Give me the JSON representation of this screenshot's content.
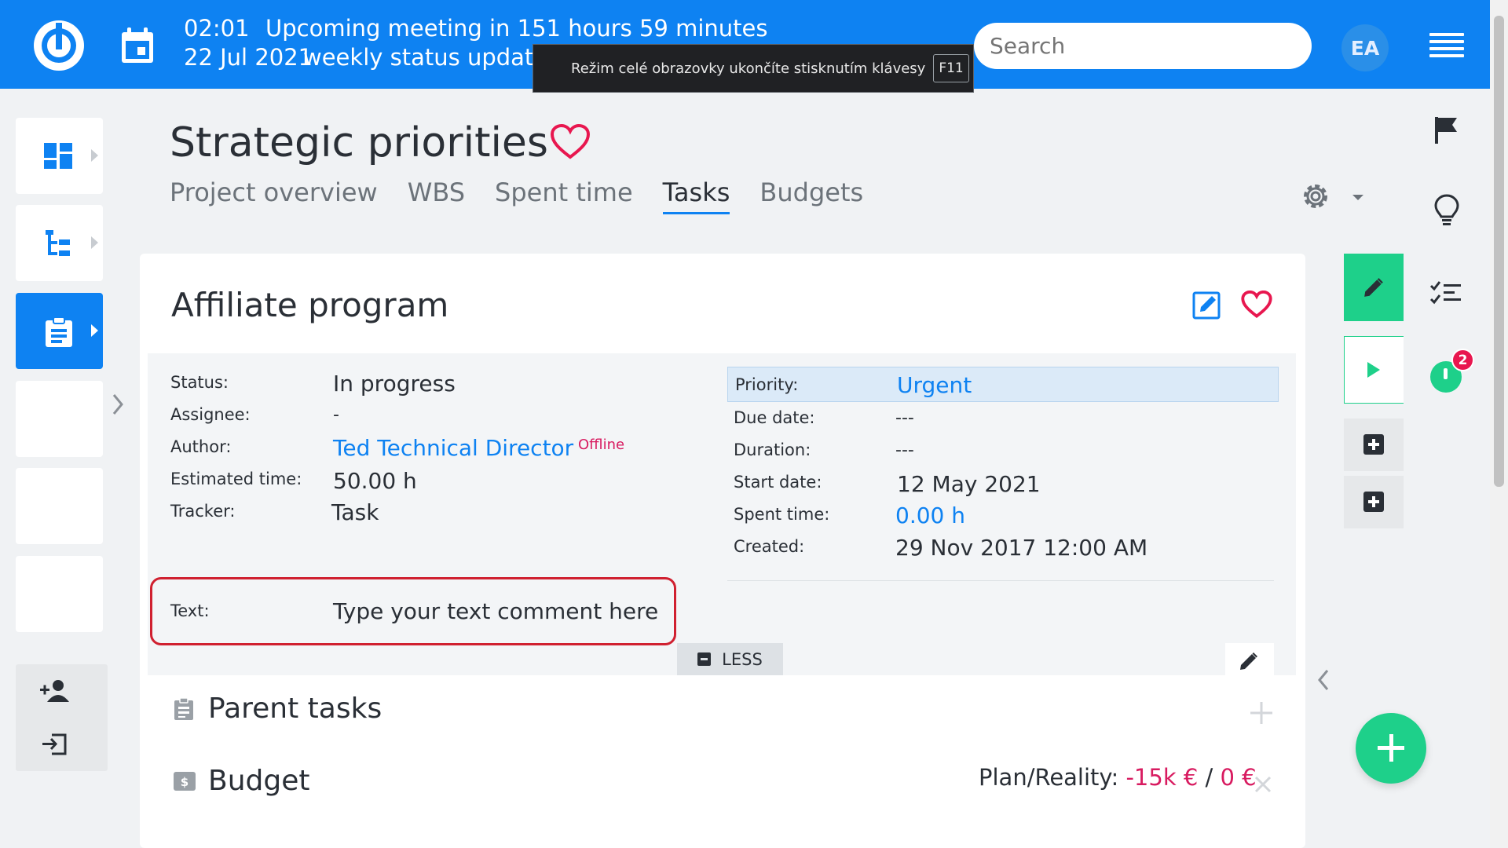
{
  "topbar": {
    "meeting": [
      {
        "time": "02:01",
        "title": "Upcoming meeting in 151 hours 59 minutes"
      },
      {
        "time": "22 Jul 2021",
        "title": "weekly status update"
      }
    ],
    "search_placeholder": "Search",
    "avatar_initials": "EA"
  },
  "tooltip": {
    "text": "Režim celé obrazovky ukončíte stisknutím klávesy",
    "key": "F11"
  },
  "header": {
    "title": "Strategic priorities",
    "tabs": [
      "Project overview",
      "WBS",
      "Spent time",
      "Tasks",
      "Budgets"
    ],
    "active_tab": "Tasks"
  },
  "task": {
    "title": "Affiliate program",
    "left_attrs": [
      {
        "label": "Status:",
        "value": "In progress"
      },
      {
        "label": "Assignee:",
        "value": "-"
      },
      {
        "label": "Author:",
        "value": "Ted Technical Director"
      },
      {
        "label": "Estimated time:",
        "value": "50.00 h"
      },
      {
        "label": "Tracker:",
        "value": "Task"
      }
    ],
    "author_status": "Offline",
    "right_attrs": [
      {
        "label": "Priority:",
        "value": "Urgent"
      },
      {
        "label": "Due date:",
        "value": "---"
      },
      {
        "label": "Duration:",
        "value": "---"
      },
      {
        "label": "Start date:",
        "value": "12 May 2021"
      },
      {
        "label": "Spent time:",
        "value": "0.00 h"
      },
      {
        "label": "Created:",
        "value": "29 Nov 2017 12:00 AM"
      }
    ],
    "text_label": "Text:",
    "text_value": "Type your text comment here",
    "less_label": "LESS"
  },
  "sections": {
    "parent_tasks": "Parent tasks",
    "budget": "Budget",
    "plan_reality_label": "Plan/Reality:",
    "plan_value": "-15k €",
    "separator": "/",
    "reality_value": "0 €"
  },
  "notifications": {
    "timer_badge": "2"
  },
  "colors": {
    "brand": "#0e82f2",
    "success": "#1ed08a",
    "danger": "#d81b60",
    "highlight": "#d02030"
  }
}
